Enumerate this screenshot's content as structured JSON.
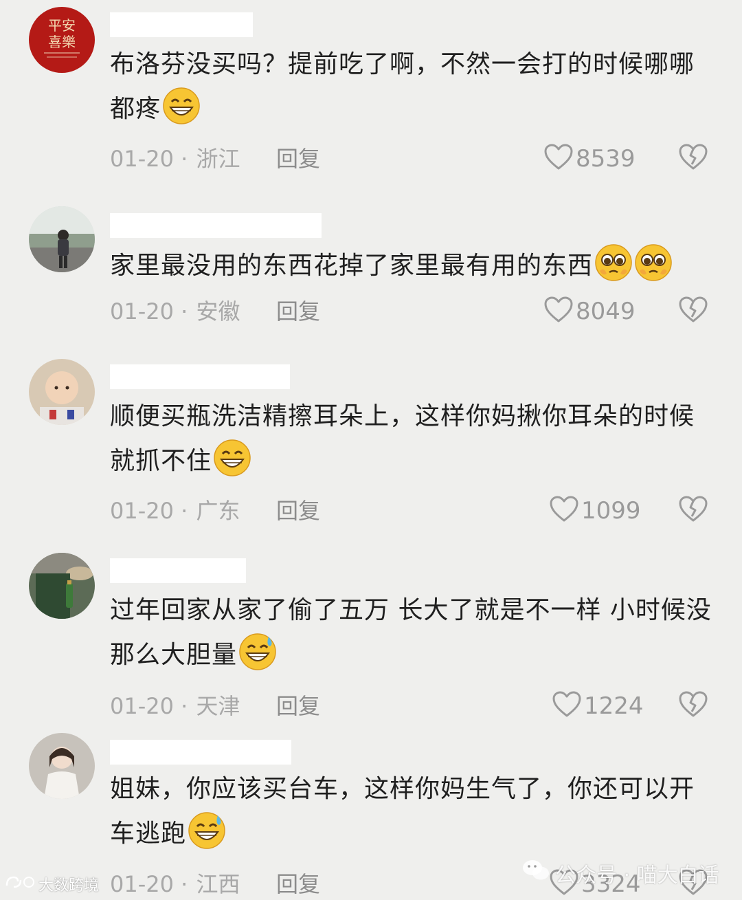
{
  "colors": {
    "background": "#efefed",
    "meta_text": "#a8a8a8",
    "reply_text": "#8c8c8c"
  },
  "comments": [
    {
      "avatar": "red-square-calligraphy-avatar",
      "avatar_text": [
        "平安",
        "喜樂"
      ],
      "text": "布洛芬没买吗？提前吃了啊，不然一会打的时候哪哪都疼",
      "emojis": [
        "grin-emoji"
      ],
      "date": "01-20",
      "region": "浙江",
      "reply_label": "回复",
      "likes": "8539"
    },
    {
      "avatar": "girl-photo-avatar",
      "text": "家里最没用的东西花掉了家里最有用的东西",
      "emojis": [
        "pleading-emoji",
        "pleading-emoji"
      ],
      "date": "01-20",
      "region": "安徽",
      "reply_label": "回复",
      "likes": "8049"
    },
    {
      "avatar": "baby-photo-avatar",
      "text": "顺便买瓶洗洁精擦耳朵上，这样你妈揪你耳朵的时候就抓不住",
      "emojis": [
        "grin-emoji"
      ],
      "date": "01-20",
      "region": "广东",
      "reply_label": "回复",
      "likes": "1099"
    },
    {
      "avatar": "green-shirt-photo-avatar",
      "text": "过年回家从家了偷了五万  长大了就是不一样  小时候没那么大胆量",
      "emojis": [
        "grin-sweat-emoji"
      ],
      "date": "01-20",
      "region": "天津",
      "reply_label": "回复",
      "likes": "1224"
    },
    {
      "avatar": "white-dress-photo-avatar",
      "text": "姐妹，你应该买台车，这样你妈生气了，你还可以开车逃跑",
      "emojis": [
        "grin-sweat-emoji"
      ],
      "date": "01-20",
      "region": "江西",
      "reply_label": "回复",
      "likes": "3324"
    }
  ],
  "watermarks": {
    "left": "大数跨境",
    "right": "公众号 · 喵大白话"
  }
}
